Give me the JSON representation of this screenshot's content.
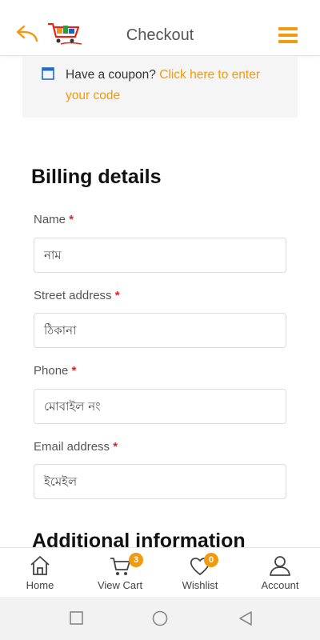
{
  "header": {
    "title": "Checkout",
    "back_icon": "back-arrow-icon",
    "menu_icon": "hamburger-menu-icon",
    "accent_color": "#f29a0d"
  },
  "coupon": {
    "prompt": "Have a coupon?",
    "link": "Click here to enter your code"
  },
  "billing": {
    "title": "Billing details",
    "fields": [
      {
        "label": "Name",
        "required": "*",
        "placeholder": "নাম"
      },
      {
        "label": "Street address",
        "required": "*",
        "placeholder": "ঠিকানা"
      },
      {
        "label": "Phone",
        "required": "*",
        "placeholder": "মোবাইল নং"
      },
      {
        "label": "Email address",
        "required": "*",
        "placeholder": "ইমেইল"
      }
    ]
  },
  "additional": {
    "title": "Additional information"
  },
  "bottom_nav": {
    "items": [
      {
        "label": "Home",
        "icon": "home-icon"
      },
      {
        "label": "View Cart",
        "icon": "cart-icon",
        "badge": "3"
      },
      {
        "label": "Wishlist",
        "icon": "heart-icon",
        "badge": "0"
      },
      {
        "label": "Account",
        "icon": "user-icon"
      }
    ]
  }
}
